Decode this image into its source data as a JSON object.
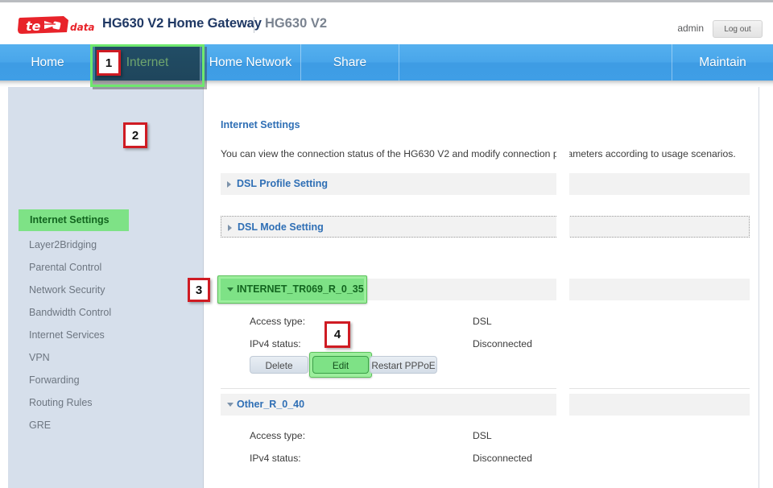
{
  "header": {
    "logo_text_primary": "te",
    "logo_text_secondary": "data",
    "title": "HG630 V2 Home Gateway",
    "model": "HG630 V2",
    "user": "admin",
    "logout_label": "Log out"
  },
  "nav": {
    "items": [
      {
        "label": "Home",
        "active": false
      },
      {
        "label": "Internet",
        "active": true
      },
      {
        "label": "Home Network",
        "active": false
      },
      {
        "label": "Share",
        "active": false
      },
      {
        "label": "Maintain",
        "active": false
      }
    ]
  },
  "sidebar": {
    "items": [
      {
        "label": "Internet Settings",
        "active": true
      },
      {
        "label": "Layer2Bridging",
        "active": false
      },
      {
        "label": "Parental Control",
        "active": false
      },
      {
        "label": "Network Security",
        "active": false
      },
      {
        "label": "Bandwidth Control",
        "active": false
      },
      {
        "label": "Internet Services",
        "active": false
      },
      {
        "label": "VPN",
        "active": false
      },
      {
        "label": "Forwarding",
        "active": false
      },
      {
        "label": "Routing Rules",
        "active": false
      },
      {
        "label": "GRE",
        "active": false
      }
    ]
  },
  "content": {
    "title": "Internet Settings",
    "description": "You can view the connection status of the HG630 V2 and modify connection parameters according to usage scenarios.",
    "collapsed_sections": [
      {
        "label": "DSL Profile Setting",
        "focused": false
      },
      {
        "label": "DSL Mode Setting",
        "focused": true
      }
    ],
    "connections": [
      {
        "name": "INTERNET_TR069_R_0_35",
        "highlighted": true,
        "access_type_label": "Access type:",
        "access_type_value": "DSL",
        "ipv4_status_label": "IPv4 status:",
        "ipv4_status_value": "Disconnected",
        "buttons": [
          {
            "label": "Delete",
            "highlighted": false
          },
          {
            "label": "Edit",
            "highlighted": true
          },
          {
            "label": "Restart PPPoE",
            "highlighted": false
          }
        ]
      },
      {
        "name": "Other_R_0_40",
        "highlighted": false,
        "access_type_label": "Access type:",
        "access_type_value": "DSL",
        "ipv4_status_label": "IPv4 status:",
        "ipv4_status_value": "Disconnected",
        "buttons": []
      }
    ]
  },
  "callouts": [
    {
      "number": "1"
    },
    {
      "number": "2"
    },
    {
      "number": "3"
    },
    {
      "number": "4"
    }
  ],
  "colors": {
    "brand_red": "#e8232a",
    "nav_blue": "#49a6ea",
    "nav_active_dark": "#0d547c",
    "highlight_green": "#7ee286",
    "callout_red": "#cf1b23",
    "link_blue": "#2f6fb5",
    "sidebar_bg": "#d6dfeb"
  }
}
